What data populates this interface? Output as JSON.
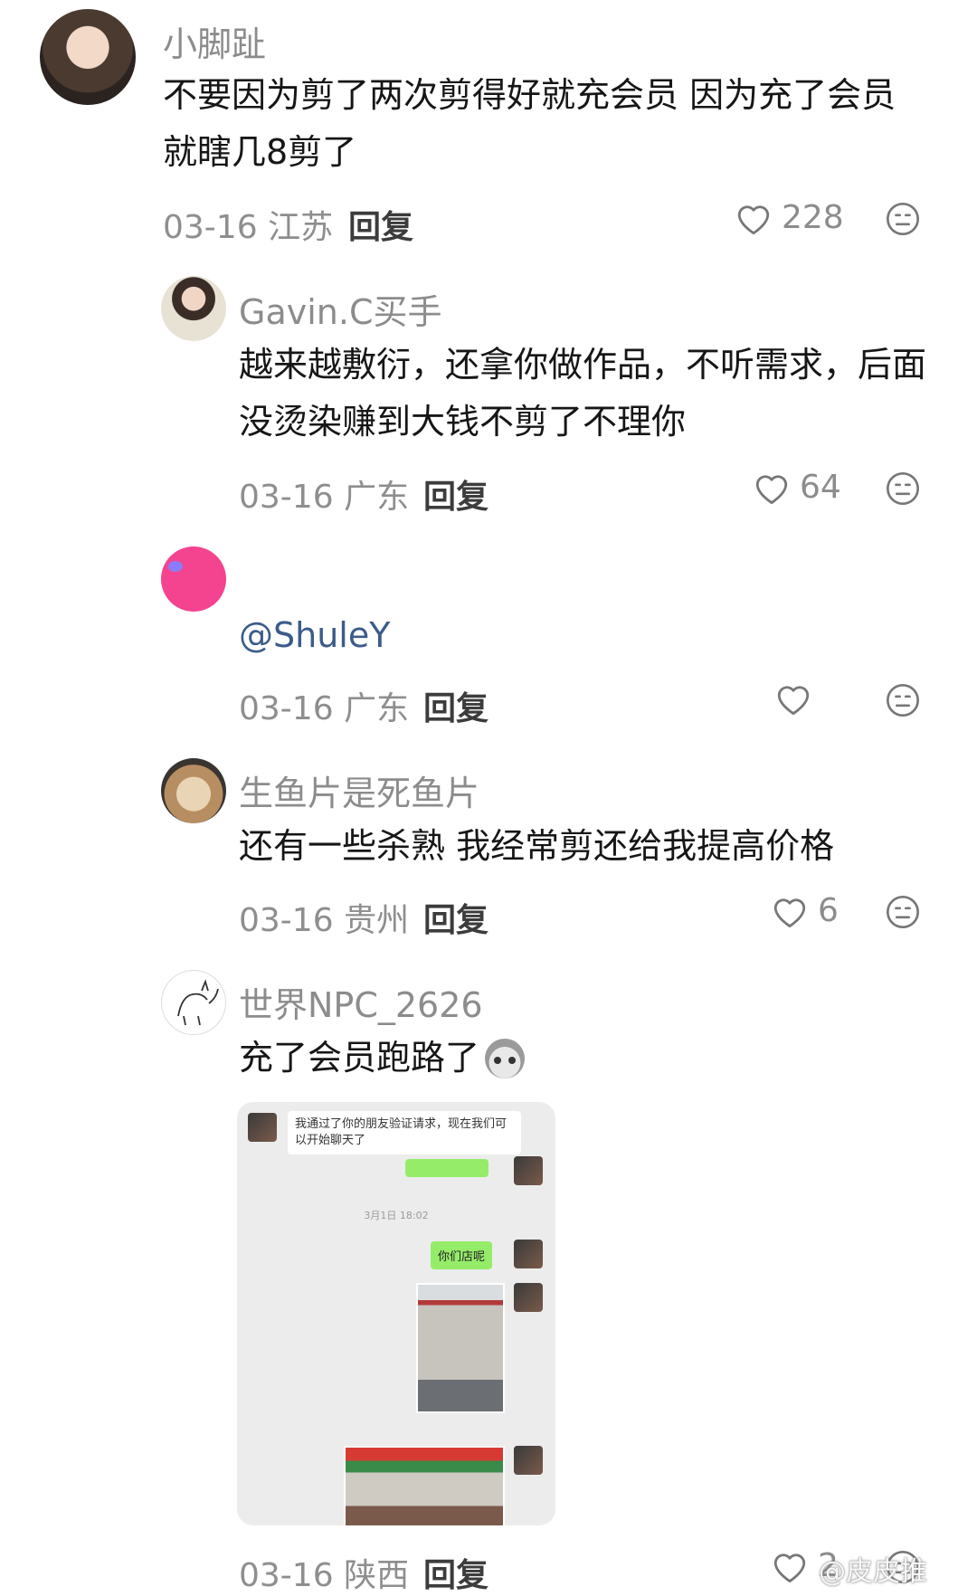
{
  "comments": [
    {
      "username": "小脚趾",
      "content": "不要因为剪了两次剪得好就充会员 因为充了会员就瞎几8剪了",
      "date": "03-16",
      "location": "江苏",
      "reply": "回复",
      "likes": "228"
    },
    {
      "username": "Gavin.C买手",
      "content": "越来越敷衍，还拿你做作品，不听需求，后面没烫染赚到大钱不剪了不理你",
      "date": "03-16",
      "location": "广东",
      "reply": "回复",
      "likes": "64"
    },
    {
      "username": "",
      "content": "@ShuleY",
      "date": "03-16",
      "location": "广东",
      "reply": "回复",
      "likes": ""
    },
    {
      "username": "生鱼片是死鱼片",
      "content": "还有一些杀熟 我经常剪还给我提高价格",
      "date": "03-16",
      "location": "贵州",
      "reply": "回复",
      "likes": "6"
    },
    {
      "username": "世界NPC_2626",
      "content": "充了会员跑路了",
      "date": "03-16",
      "location": "陕西",
      "reply": "回复",
      "likes": "2"
    }
  ],
  "chat_screenshot": {
    "system_message": "我通过了你的朋友验证请求，现在我们可以开始聊天了",
    "time": "3月1日 18:02",
    "message": "你们店呢"
  },
  "watermark": "@皮皮推",
  "icons": {
    "like": "heart-outline-icon",
    "dislike": "neutral-face-icon"
  },
  "colors": {
    "username": "#8c8c8c",
    "meta": "#8e8e8e",
    "mention": "#3b5b8a",
    "wechat_green": "#95ec69"
  }
}
